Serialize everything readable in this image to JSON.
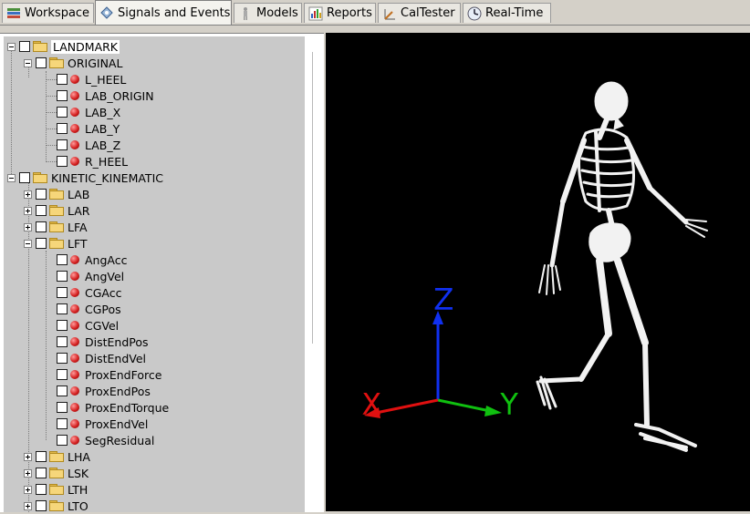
{
  "tabs": [
    {
      "label": "Workspace",
      "icon": "workspace-icon"
    },
    {
      "label": "Signals and Events",
      "icon": "signals-icon",
      "active": true
    },
    {
      "label": "Models",
      "icon": "models-icon"
    },
    {
      "label": "Reports",
      "icon": "reports-icon"
    },
    {
      "label": "CalTester",
      "icon": "caltester-icon"
    },
    {
      "label": "Real-Time",
      "icon": "realtime-icon"
    }
  ],
  "tree": {
    "landmark": {
      "label": "LANDMARK",
      "original": {
        "label": "ORIGINAL",
        "items": [
          "L_HEEL",
          "LAB_ORIGIN",
          "LAB_X",
          "LAB_Y",
          "LAB_Z",
          "R_HEEL"
        ]
      }
    },
    "kinetic": {
      "label": "KINETIC_KINEMATIC",
      "collapsed_before": [
        "LAB",
        "LAR",
        "LFA"
      ],
      "lft": {
        "label": "LFT",
        "items": [
          "AngAcc",
          "AngVel",
          "CGAcc",
          "CGPos",
          "CGVel",
          "DistEndPos",
          "DistEndVel",
          "ProxEndForce",
          "ProxEndPos",
          "ProxEndTorque",
          "ProxEndVel",
          "SegResidual"
        ]
      },
      "collapsed_after": [
        "LHA",
        "LSK",
        "LTH",
        "LTO"
      ]
    }
  },
  "viewport": {
    "axis_x_label": "X",
    "axis_y_label": "Y",
    "axis_z_label": "Z",
    "colors": {
      "x": "#e01010",
      "y": "#10c010",
      "z": "#1030f0"
    }
  }
}
